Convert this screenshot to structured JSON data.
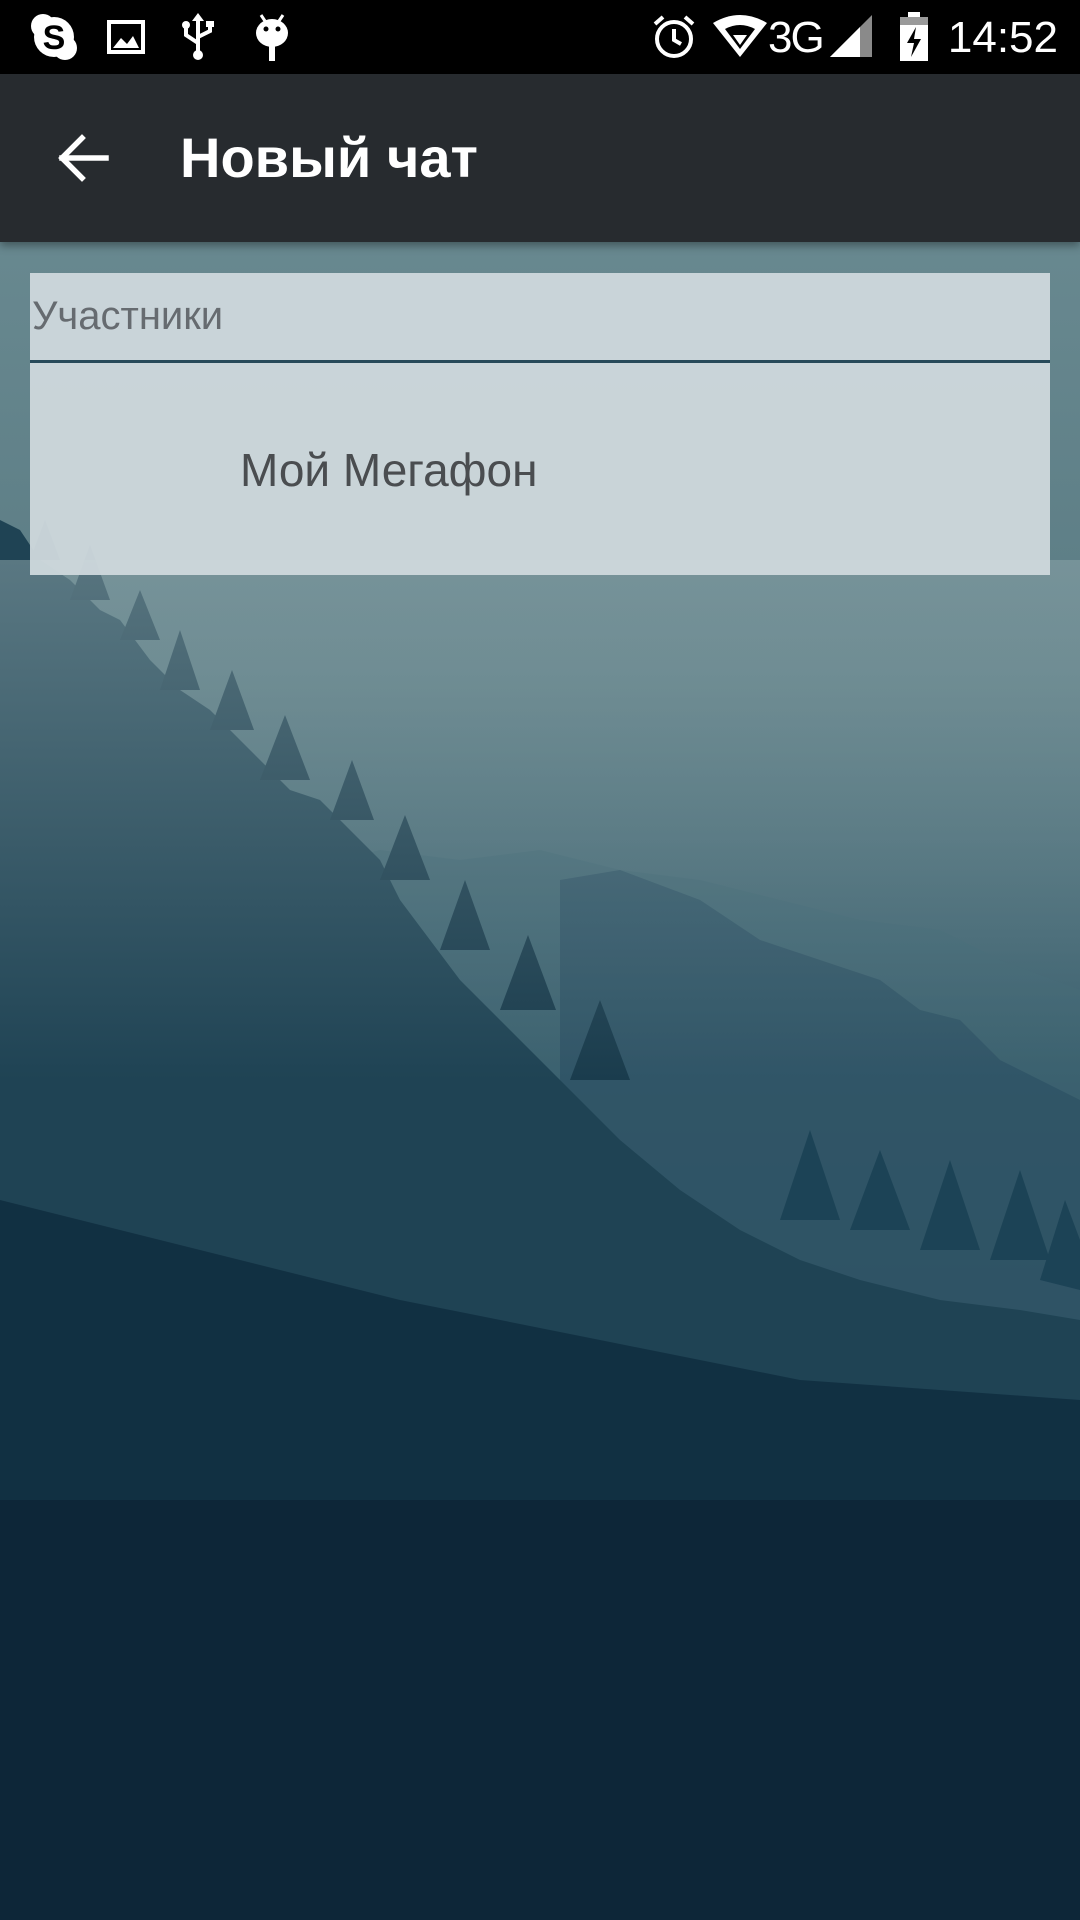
{
  "status_bar": {
    "icons_left": [
      "skype-icon",
      "image-icon",
      "usb-icon",
      "android-debug-icon"
    ],
    "icons_right": [
      "alarm-icon",
      "wifi-icon",
      "signal-icon",
      "battery-charging-icon"
    ],
    "network": "3G",
    "time": "14:52"
  },
  "toolbar": {
    "back_icon": "arrow-back-icon",
    "title": "Новый чат"
  },
  "participants": {
    "placeholder": "Участники",
    "value": ""
  },
  "contacts": [
    {
      "name": "Мой Мегафон"
    }
  ],
  "colors": {
    "status_bar": "#000000",
    "toolbar": "#272b2f",
    "card": "#cdd7dc",
    "underline": "#274a5a",
    "wallpaper_top": "#5e7f87",
    "wallpaper_bottom": "#0b2335"
  }
}
